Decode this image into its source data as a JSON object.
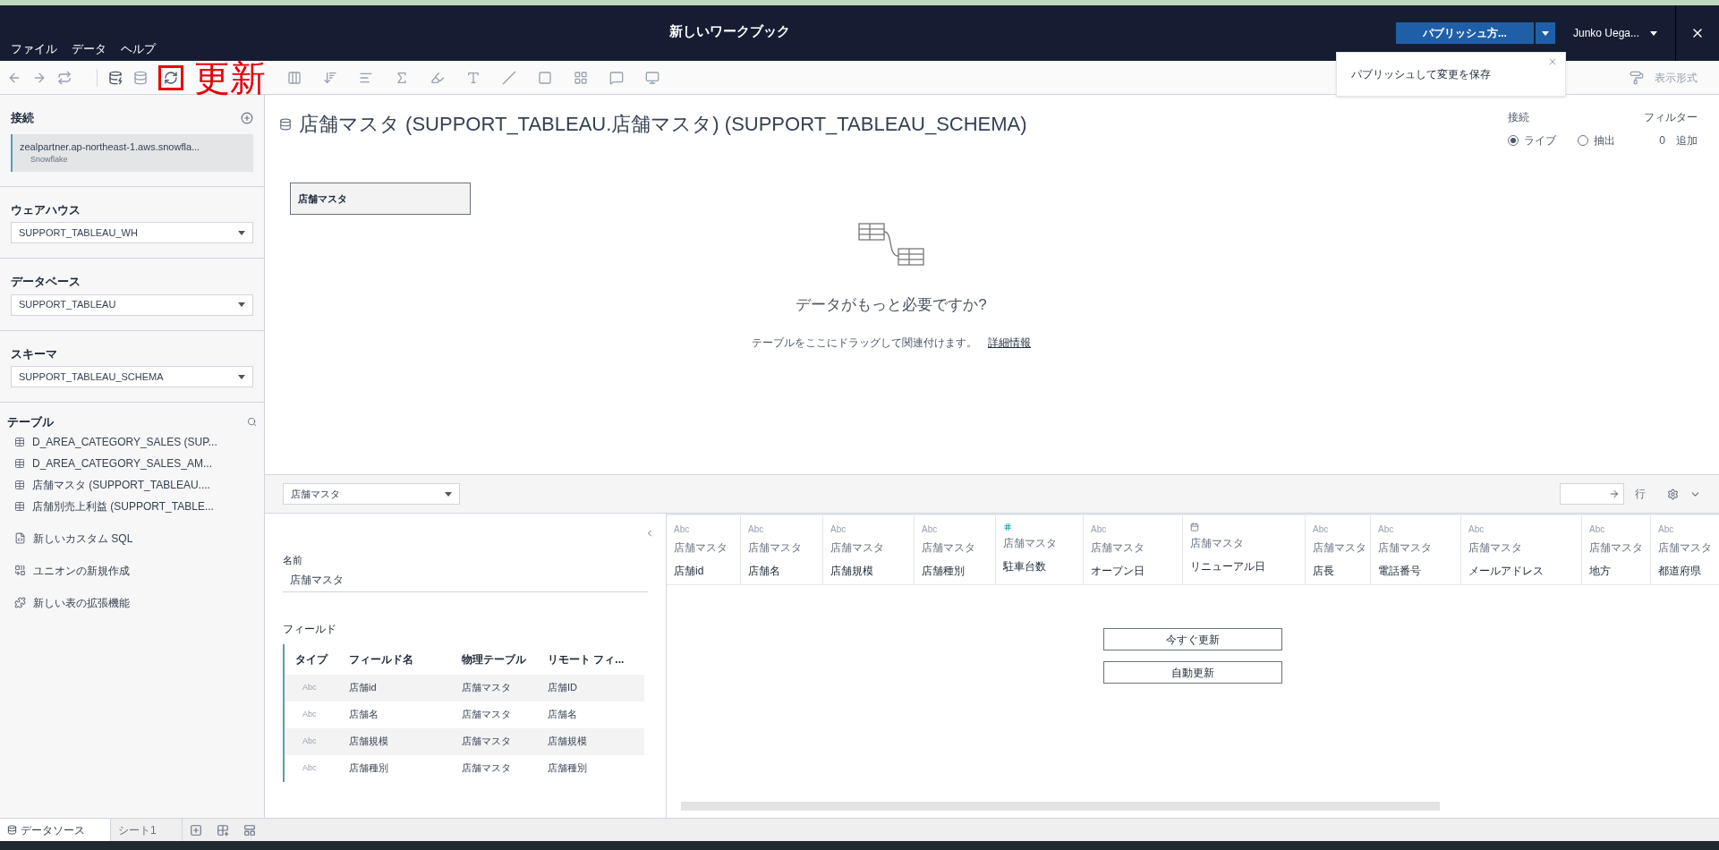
{
  "window": {
    "title": "新しいワークブック",
    "menus": [
      "ファイル",
      "データ",
      "ヘルプ"
    ],
    "publish_button": "パブリッシュ方...",
    "user": "Junko Uega...",
    "popover": "パブリッシュして変更を保存"
  },
  "toolbar": {
    "annotation": "更新",
    "format_label": "表示形式"
  },
  "sidebar": {
    "connection_heading": "接続",
    "connection": {
      "server": "zealpartner.ap-northeast-1.aws.snowfla...",
      "type": "Snowflake"
    },
    "selects": [
      {
        "label": "ウェアハウス",
        "value": "SUPPORT_TABLEAU_WH"
      },
      {
        "label": "データベース",
        "value": "SUPPORT_TABLEAU"
      },
      {
        "label": "スキーマ",
        "value": "SUPPORT_TABLEAU_SCHEMA"
      }
    ],
    "tables_heading": "テーブル",
    "tables": [
      "D_AREA_CATEGORY_SALES (SUP...",
      "D_AREA_CATEGORY_SALES_AM...",
      "店舗マスタ (SUPPORT_TABLEAU....",
      "店舗別売上利益 (SUPPORT_TABLE..."
    ],
    "actions": [
      {
        "kind": "sql",
        "label": "新しいカスタム SQL"
      },
      {
        "kind": "union",
        "label": "ユニオンの新規作成"
      },
      {
        "kind": "extension",
        "label": "新しい表の拡張機能"
      }
    ]
  },
  "datasource": {
    "title": "店舗マスタ (SUPPORT_TABLEAU.店舗マスタ) (SUPPORT_TABLEAU_SCHEMA)",
    "connection_label": "接続",
    "modes": [
      {
        "label": "ライブ",
        "selected": true
      },
      {
        "label": "抽出",
        "selected": false
      }
    ],
    "filter_label": "フィルター",
    "filter_count": "0",
    "filter_add": "追加",
    "table_node": "店舗マスタ",
    "hint_title": "データがもっと必要ですか?",
    "hint_text": "テーブルをここにドラッグして関連付けます。",
    "hint_link": "詳細情報"
  },
  "bottom_pane": {
    "table_select": "店舗マスタ",
    "rows_label": "行",
    "name_label": "名前",
    "name_value": "店舗マスタ",
    "fields_heading": "フィールド",
    "field_columns": [
      "タイプ",
      "フィールド名",
      "物理テーブル",
      "リモート フィ..."
    ],
    "fields": [
      {
        "type": "Abc",
        "name": "店舗id",
        "table": "店舗マスタ",
        "remote": "店舗ID"
      },
      {
        "type": "Abc",
        "name": "店舗名",
        "table": "店舗マスタ",
        "remote": "店舗名"
      },
      {
        "type": "Abc",
        "name": "店舗規模",
        "table": "店舗マスタ",
        "remote": "店舗規模"
      },
      {
        "type": "Abc",
        "name": "店舗種別",
        "table": "店舗マスタ",
        "remote": "店舗種別"
      }
    ],
    "grid_columns": [
      {
        "kind": "text",
        "type": "Abc",
        "table": "店舗マスタ",
        "name": "店舗id"
      },
      {
        "kind": "text",
        "type": "Abc",
        "table": "店舗マスタ",
        "name": "店舗名"
      },
      {
        "kind": "text",
        "type": "Abc",
        "table": "店舗マスタ",
        "name": "店舗規模"
      },
      {
        "kind": "text",
        "type": "Abc",
        "table": "店舗マスタ",
        "name": "店舗種別"
      },
      {
        "kind": "number",
        "table": "店舗マスタ",
        "name": "駐車台数"
      },
      {
        "kind": "text",
        "type": "Abc",
        "table": "店舗マスタ",
        "name": "オープン日"
      },
      {
        "kind": "date",
        "table": "店舗マスタ",
        "name": "リニューアル日"
      },
      {
        "kind": "text",
        "type": "Abc",
        "table": "店舗マスタ",
        "name": "店長"
      },
      {
        "kind": "text",
        "type": "Abc",
        "table": "店舗マスタ",
        "name": "電話番号"
      },
      {
        "kind": "text",
        "type": "Abc",
        "table": "店舗マスタ",
        "name": "メールアドレス"
      },
      {
        "kind": "text",
        "type": "Abc",
        "table": "店舗マスタ",
        "name": "地方"
      },
      {
        "kind": "text",
        "type": "Abc",
        "table": "店舗マスタ",
        "name": "都道府県"
      }
    ],
    "update_buttons": [
      "今すぐ更新",
      "自動更新"
    ]
  },
  "sheet_tabs": [
    {
      "label": "データソース",
      "kind": "datasource",
      "selected": true
    },
    {
      "label": "シート1",
      "kind": "sheet",
      "selected": false
    }
  ]
}
